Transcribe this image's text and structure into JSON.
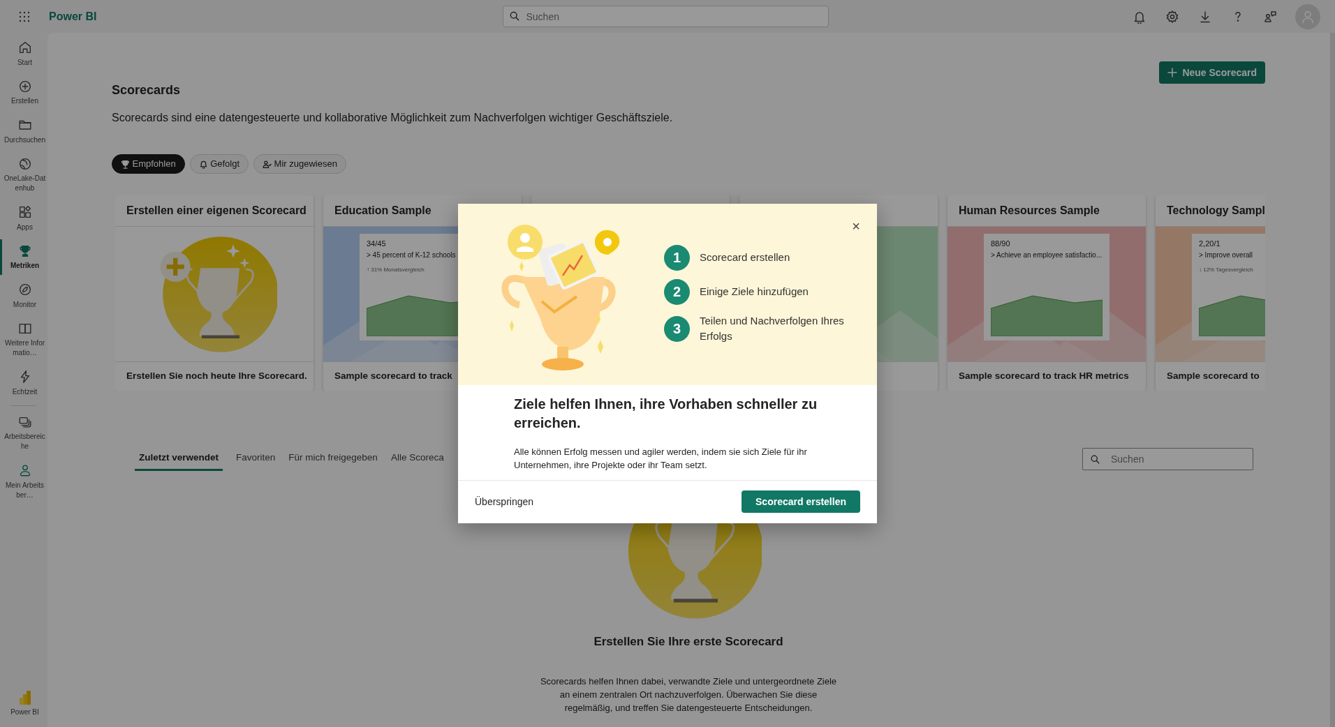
{
  "topbar": {
    "app_name": "Power BI",
    "search": {
      "placeholder": "Suchen"
    }
  },
  "sidebar": {
    "items": [
      {
        "label": "Start",
        "selected": false
      },
      {
        "label": "Erstellen",
        "selected": false
      },
      {
        "label": "Durchsuchen",
        "selected": false
      },
      {
        "label": "OneLake-Datenhub",
        "selected": false
      },
      {
        "label": "Apps",
        "selected": false
      },
      {
        "label": "Metriken",
        "selected": true
      },
      {
        "label": "Monitor",
        "selected": false
      },
      {
        "label": "Weitere Informatio…",
        "selected": false
      },
      {
        "label": "Echtzeit",
        "selected": false
      },
      {
        "label": "Arbeitsbereiche",
        "selected": false
      },
      {
        "label": "Mein Arbeitsber…",
        "selected": false
      }
    ],
    "footer": {
      "label": "Power BI"
    }
  },
  "page": {
    "title": "Scorecards",
    "description": "Scorecards sind eine datengesteuerte und kollaborative Möglichkeit zum Nachverfolgen wichtiger Geschäftsziele.",
    "new_button": "Neue Scorecard"
  },
  "filters": [
    {
      "label": "Empfohlen",
      "selected": true
    },
    {
      "label": "Gefolgt",
      "selected": false
    },
    {
      "label": "Mir zugewiesen",
      "selected": false
    }
  ],
  "cards": [
    {
      "kind": "create",
      "title": "Erstellen einer eigenen Scorecard",
      "footer": "Erstellen Sie noch heute Ihre Scorecard."
    },
    {
      "kind": "sample",
      "title": "Education Sample",
      "metric": {
        "value": "34/45",
        "goal": "> 45 percent of K-12 schools",
        "change": "↑ 31% Monatsvergleich"
      },
      "footer": "Sample scorecard to track"
    },
    {
      "kind": "blank"
    },
    {
      "kind": "sample"
    },
    {
      "kind": "sample",
      "title": "Human Resources Sample",
      "metric": {
        "value": "88/90",
        "goal": "> Achieve an employee satisfactio..."
      },
      "footer": "Sample scorecard to track HR metrics"
    },
    {
      "kind": "sample",
      "title": "Technology Sampl",
      "metric": {
        "value": "2,20/1",
        "goal": "> Improve overall",
        "change": "↓ 12% Tagesvergleich"
      },
      "footer": "Sample scorecard to"
    }
  ],
  "tabs": [
    {
      "label": "Zuletzt verwendet",
      "selected": true
    },
    {
      "label": "Favoriten",
      "selected": false
    },
    {
      "label": "Für mich freigegeben",
      "selected": false
    },
    {
      "label": "Alle Scoreca",
      "selected": false
    }
  ],
  "list_search": {
    "placeholder": "Suchen"
  },
  "empty_state": {
    "title": "Erstellen Sie Ihre erste Scorecard",
    "description": "Scorecards helfen Ihnen dabei, verwandte Ziele und untergeordnete Ziele an einem zentralen Ort nachzuverfolgen. Überwachen Sie diese regelmäßig, und treffen Sie datengesteuerte Entscheidungen."
  },
  "dialog": {
    "steps": [
      {
        "number": "1",
        "text": "Scorecard erstellen"
      },
      {
        "number": "2",
        "text": "Einige Ziele hinzufügen"
      },
      {
        "number": "3",
        "text": "Teilen und Nachverfolgen Ihres Erfolgs"
      }
    ],
    "close": "×",
    "title": "Ziele helfen Ihnen, ihre Vorhaben schneller zu erreichen.",
    "text": "Alle können Erfolg messen und agiler werden, indem sie sich Ziele für ihr Unternehmen, ihre Projekte oder ihr Team setzt.",
    "skip_button": "Überspringen",
    "primary_button": "Scorecard erstellen"
  }
}
